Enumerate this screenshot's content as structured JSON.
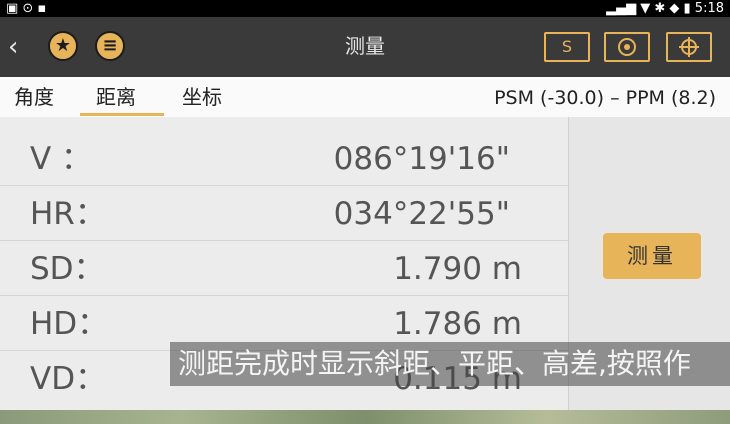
{
  "statusbar": {
    "left_icons": "▣ ⊙ ▪",
    "time": "5:18"
  },
  "header": {
    "back_glyph": "‹",
    "title": "测量",
    "s_button": "S",
    "icon_names": [
      "star-icon",
      "database-icon",
      "prism-icon",
      "target-icon"
    ]
  },
  "tabs": [
    {
      "label": "角度"
    },
    {
      "label": "距离"
    },
    {
      "label": "坐标"
    }
  ],
  "psm_ppm": "PSM (-30.0)  – PPM (8.2)",
  "rows": [
    {
      "label": "V  ：",
      "value": "086°19'16\""
    },
    {
      "label": "HR：",
      "value": "034°22'55\""
    },
    {
      "label": "SD：",
      "value": "1.790  m"
    },
    {
      "label": "HD：",
      "value": "1.786  m"
    },
    {
      "label": "VD：",
      "value": "0.115  m"
    }
  ],
  "measure_button": "测量",
  "subtitle": "测距完成时显示斜距、平距、高差,按照作"
}
